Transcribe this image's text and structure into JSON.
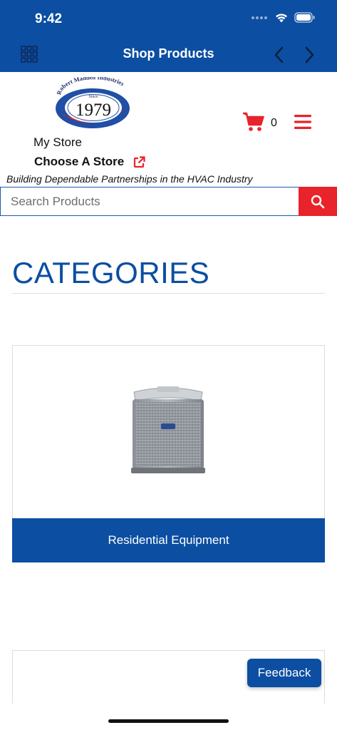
{
  "status_bar": {
    "time": "9:42"
  },
  "nav": {
    "title": "Shop Products",
    "grid_icon": "grid-icon",
    "back_icon": "chevron-left-icon",
    "forward_icon": "chevron-right-icon"
  },
  "logo": {
    "top_text": "Robert Madden Industries",
    "since": "Since",
    "year": "1979"
  },
  "cart": {
    "count": "0",
    "icon": "cart-icon"
  },
  "menu_icon": "hamburger-menu-icon",
  "store": {
    "my_store_label": "My Store",
    "choose_label": "Choose A Store",
    "external_icon": "external-link-icon"
  },
  "tagline": "Building Dependable Partnerships in the HVAC Industry",
  "search": {
    "placeholder": "Search Products",
    "button_icon": "search-icon"
  },
  "categories": {
    "heading": "CATEGORIES",
    "items": [
      {
        "label": "Residential Equipment",
        "image": "air-conditioner-unit"
      }
    ]
  },
  "feedback_label": "Feedback",
  "colors": {
    "brand_blue": "#0b4ea2",
    "accent_red": "#e8232a"
  }
}
